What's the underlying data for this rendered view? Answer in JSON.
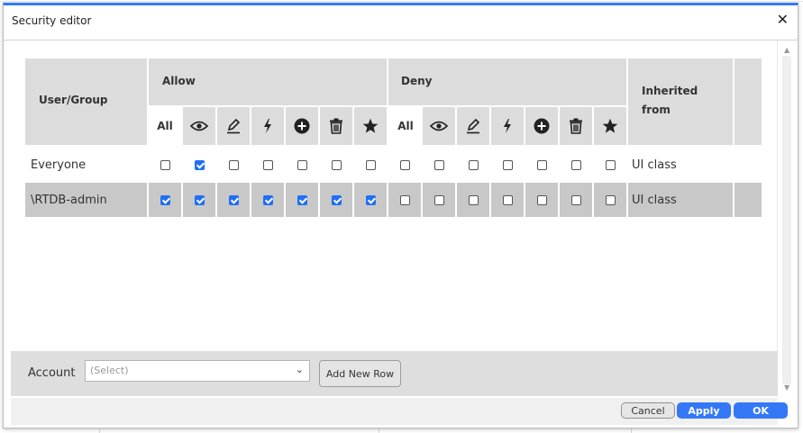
{
  "dialog": {
    "title": "Security editor",
    "close_glyph": "✕"
  },
  "table": {
    "headers": {
      "user_group": "User/Group",
      "allow": "Allow",
      "deny": "Deny",
      "inherited_line1": "Inherited",
      "inherited_line2": "from"
    },
    "icon_columns": [
      {
        "name": "all",
        "label": "All"
      },
      {
        "name": "eye-icon"
      },
      {
        "name": "pencil-icon"
      },
      {
        "name": "lightning-icon"
      },
      {
        "name": "plus-circle-icon"
      },
      {
        "name": "trash-icon"
      },
      {
        "name": "star-icon"
      }
    ],
    "rows": [
      {
        "user": "Everyone",
        "allow": [
          false,
          true,
          false,
          false,
          false,
          false,
          false
        ],
        "deny": [
          false,
          false,
          false,
          false,
          false,
          false,
          false
        ],
        "inherited": "UI class"
      },
      {
        "user": "\\RTDB-admin",
        "allow": [
          true,
          true,
          true,
          true,
          true,
          true,
          true
        ],
        "deny": [
          false,
          false,
          false,
          false,
          false,
          false,
          false
        ],
        "inherited": "UI class"
      }
    ]
  },
  "footer": {
    "account_label": "Account",
    "account_placeholder": "(Select)",
    "add_row_label": "Add New Row"
  },
  "buttons": {
    "cancel": "Cancel",
    "apply": "Apply",
    "ok": "OK"
  },
  "colors": {
    "accent": "#3478f6",
    "header_bg": "#dcdcdc",
    "selected_row": "#c8c8c8"
  }
}
